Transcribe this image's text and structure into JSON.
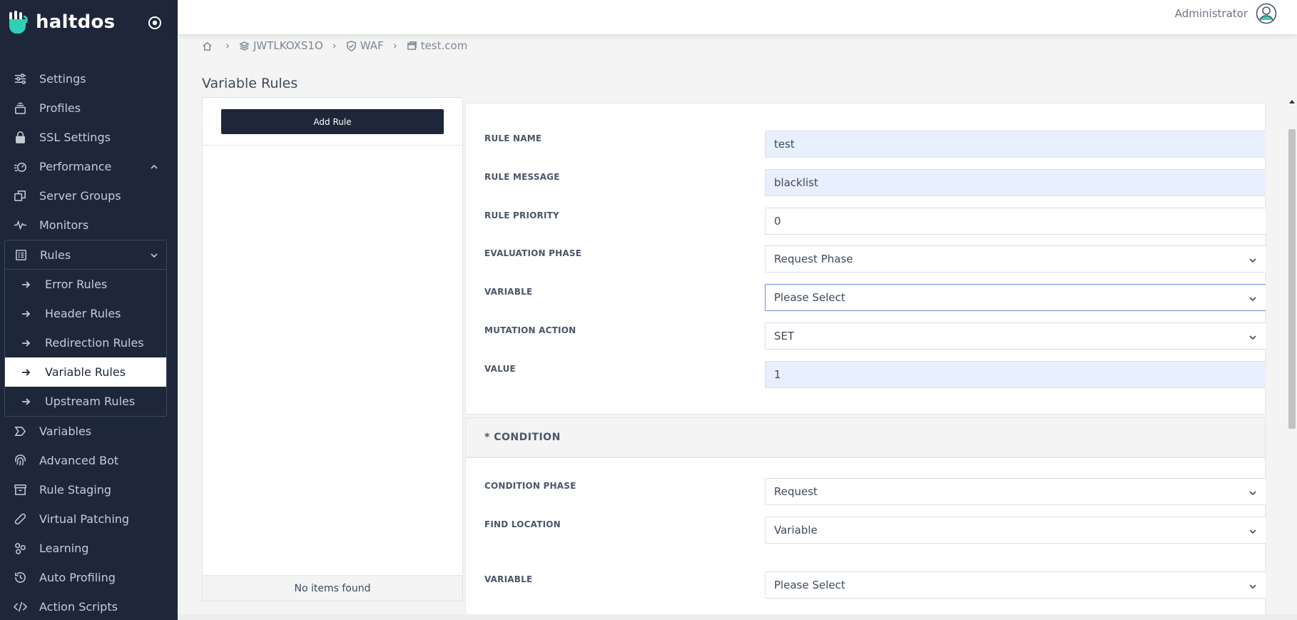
{
  "brand": {
    "name": "haltdos"
  },
  "sidebar": {
    "items_top": [
      {
        "label": "Settings",
        "icon": "sliders-icon"
      },
      {
        "label": "Profiles",
        "icon": "layers-icon"
      },
      {
        "label": "SSL Settings",
        "icon": "lock-icon"
      },
      {
        "label": "Performance",
        "icon": "speed-icon"
      },
      {
        "label": "Server Groups",
        "icon": "copy-icon"
      },
      {
        "label": "Monitors",
        "icon": "pulse-icon"
      }
    ],
    "rules_group": {
      "label": "Rules",
      "sub_items": [
        {
          "label": "Error Rules"
        },
        {
          "label": "Header Rules"
        },
        {
          "label": "Redirection Rules"
        },
        {
          "label": "Variable Rules"
        },
        {
          "label": "Upstream Rules"
        }
      ]
    },
    "items_bottom": [
      {
        "label": "Variables",
        "icon": "tag-icon"
      },
      {
        "label": "Advanced Bot",
        "icon": "fingerprint-icon"
      },
      {
        "label": "Rule Staging",
        "icon": "archive-icon"
      },
      {
        "label": "Virtual Patching",
        "icon": "bandage-icon"
      },
      {
        "label": "Learning",
        "icon": "nodes-icon"
      },
      {
        "label": "Auto Profiling",
        "icon": "history-icon"
      },
      {
        "label": "Action Scripts",
        "icon": "code-icon"
      }
    ]
  },
  "topbar": {
    "user": "Administrator"
  },
  "breadcrumb": {
    "b1": "JWTLKOXS1O",
    "b2": "WAF",
    "b3": "test.com"
  },
  "page": {
    "title": "Variable Rules"
  },
  "list_panel": {
    "add_button": "Add Rule",
    "empty_text": "No items found"
  },
  "form": {
    "rule_name": {
      "label": "RULE NAME",
      "value": "test"
    },
    "rule_message": {
      "label": "RULE MESSAGE",
      "value": "blacklist"
    },
    "rule_priority": {
      "label": "RULE PRIORITY",
      "value": "0"
    },
    "evaluation_phase": {
      "label": "EVALUATION PHASE",
      "value": "Request Phase"
    },
    "variable": {
      "label": "VARIABLE",
      "value": "Please Select"
    },
    "mutation_action": {
      "label": "MUTATION ACTION",
      "value": "SET"
    },
    "value": {
      "label": "VALUE",
      "value": "1"
    }
  },
  "condition": {
    "title": "* CONDITION",
    "condition_phase": {
      "label": "CONDITION PHASE",
      "value": "Request"
    },
    "find_location": {
      "label": "FIND LOCATION",
      "value": "Variable"
    },
    "variable": {
      "label": "VARIABLE",
      "value": "Please Select"
    }
  },
  "colors": {
    "sidebar_bg": "#1d2739",
    "filled_input": "#e8effd",
    "focus_border": "#6b8ed6"
  }
}
